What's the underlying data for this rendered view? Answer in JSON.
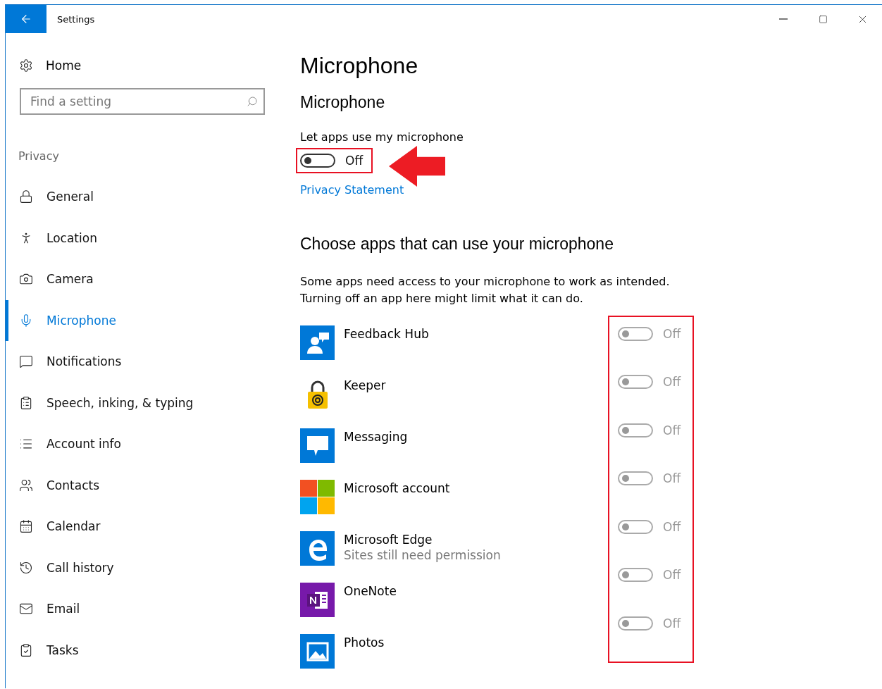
{
  "window": {
    "title": "Settings"
  },
  "sidebar": {
    "home": "Home",
    "search": {
      "placeholder": "Find a setting"
    },
    "section": "Privacy",
    "items": [
      {
        "label": "General",
        "selected": false
      },
      {
        "label": "Location",
        "selected": false
      },
      {
        "label": "Camera",
        "selected": false
      },
      {
        "label": "Microphone",
        "selected": true
      },
      {
        "label": "Notifications",
        "selected": false
      },
      {
        "label": "Speech, inking, & typing",
        "selected": false
      },
      {
        "label": "Account info",
        "selected": false
      },
      {
        "label": "Contacts",
        "selected": false
      },
      {
        "label": "Calendar",
        "selected": false
      },
      {
        "label": "Call history",
        "selected": false
      },
      {
        "label": "Email",
        "selected": false
      },
      {
        "label": "Tasks",
        "selected": false
      }
    ]
  },
  "page_title": "Microphone",
  "section_title": "Microphone",
  "main_toggle": {
    "label": "Let apps use my microphone",
    "on": false,
    "state_text": "Off"
  },
  "privacy_link": "Privacy Statement",
  "apps_heading": "Choose apps that can use your microphone",
  "apps_description": [
    "Some apps need access to your microphone to work as intended.",
    "Turning off an app here might limit what it can do."
  ],
  "apps": [
    {
      "name": "Feedback Hub",
      "on": false,
      "disabled": true,
      "state_text": "Off"
    },
    {
      "name": "Keeper",
      "on": false,
      "disabled": true,
      "state_text": "Off"
    },
    {
      "name": "Messaging",
      "on": false,
      "disabled": true,
      "state_text": "Off"
    },
    {
      "name": "Microsoft account",
      "on": false,
      "disabled": true,
      "state_text": "Off"
    },
    {
      "name": "Microsoft Edge",
      "subtitle": "Sites still need permission",
      "on": false,
      "disabled": true,
      "state_text": "Off"
    },
    {
      "name": "OneNote",
      "on": false,
      "disabled": true,
      "state_text": "Off"
    },
    {
      "name": "Photos",
      "on": false,
      "disabled": true,
      "state_text": "Off"
    }
  ]
}
